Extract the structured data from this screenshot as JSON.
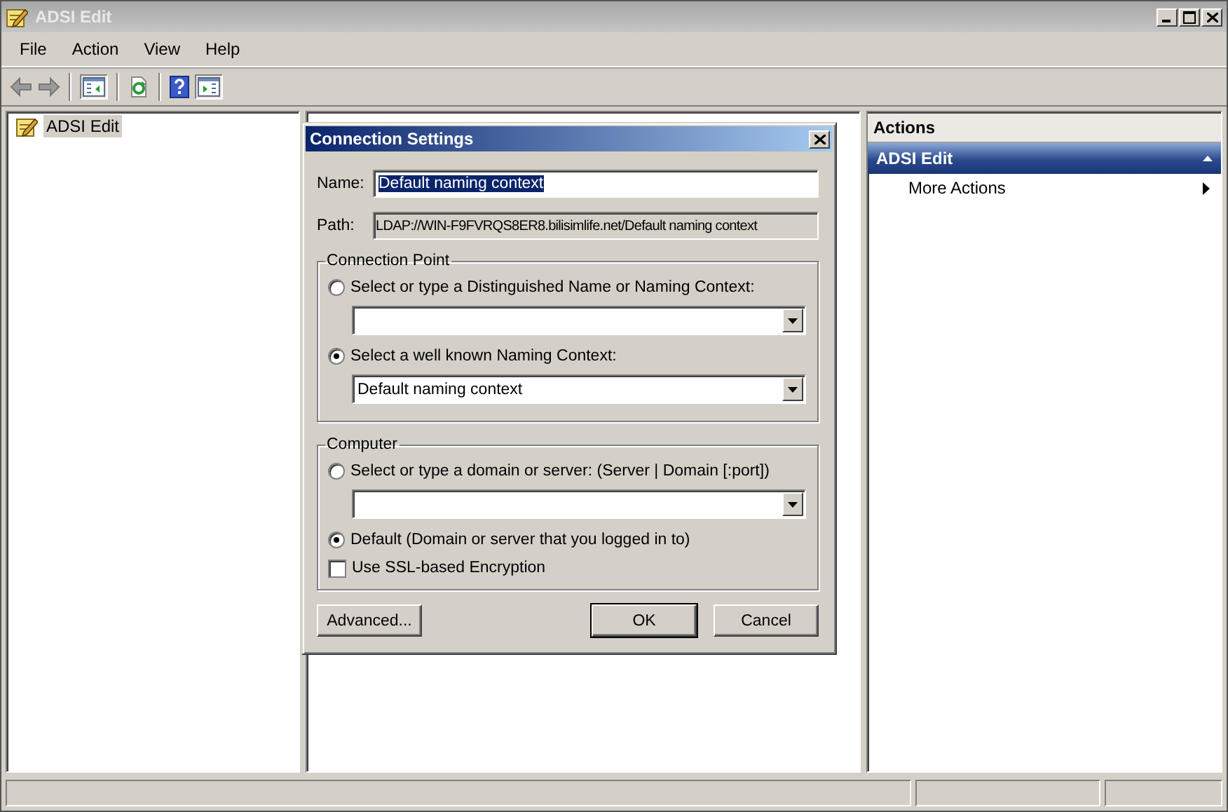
{
  "window": {
    "title": "ADSI Edit"
  },
  "menu": [
    {
      "label": "File"
    },
    {
      "label": "Action"
    },
    {
      "label": "View"
    },
    {
      "label": "Help"
    }
  ],
  "tree": {
    "items": [
      {
        "label": "ADSI Edit",
        "selected": true
      }
    ]
  },
  "actions": {
    "title": "Actions",
    "section": "ADSI Edit",
    "expanded": true,
    "items": [
      {
        "label": "More Actions"
      }
    ]
  },
  "dialog": {
    "title": "Connection Settings",
    "name": {
      "label": "Name:",
      "value": "Default naming context",
      "highlighted": true
    },
    "path": {
      "label": "Path:",
      "value": "LDAP://WIN-F9FVRQS8ER8.bilisimlife.net/Default naming context"
    },
    "connection_point": {
      "legend": "Connection Point",
      "options": [
        {
          "label": "Select or type a Distinguished Name or Naming Context:",
          "selected": false,
          "kind": "combo"
        },
        {
          "label": "Select a well known Naming Context:",
          "selected": true,
          "kind": "combo",
          "value": "Default naming context"
        }
      ]
    },
    "computer": {
      "legend": "Computer",
      "options": [
        {
          "label": "Select or type a domain or server: (Server | Domain [:port])",
          "selected": false,
          "kind": "combo"
        },
        {
          "label": "Default (Domain or server that you logged in to)",
          "selected": true,
          "kind": "plain"
        }
      ],
      "checkbox": {
        "label": "Use SSL-based Encryption",
        "checked": false
      }
    },
    "buttons": [
      {
        "label": "Advanced...",
        "default": false
      },
      {
        "label": "OK",
        "default": true
      },
      {
        "label": "Cancel",
        "default": false
      }
    ]
  }
}
